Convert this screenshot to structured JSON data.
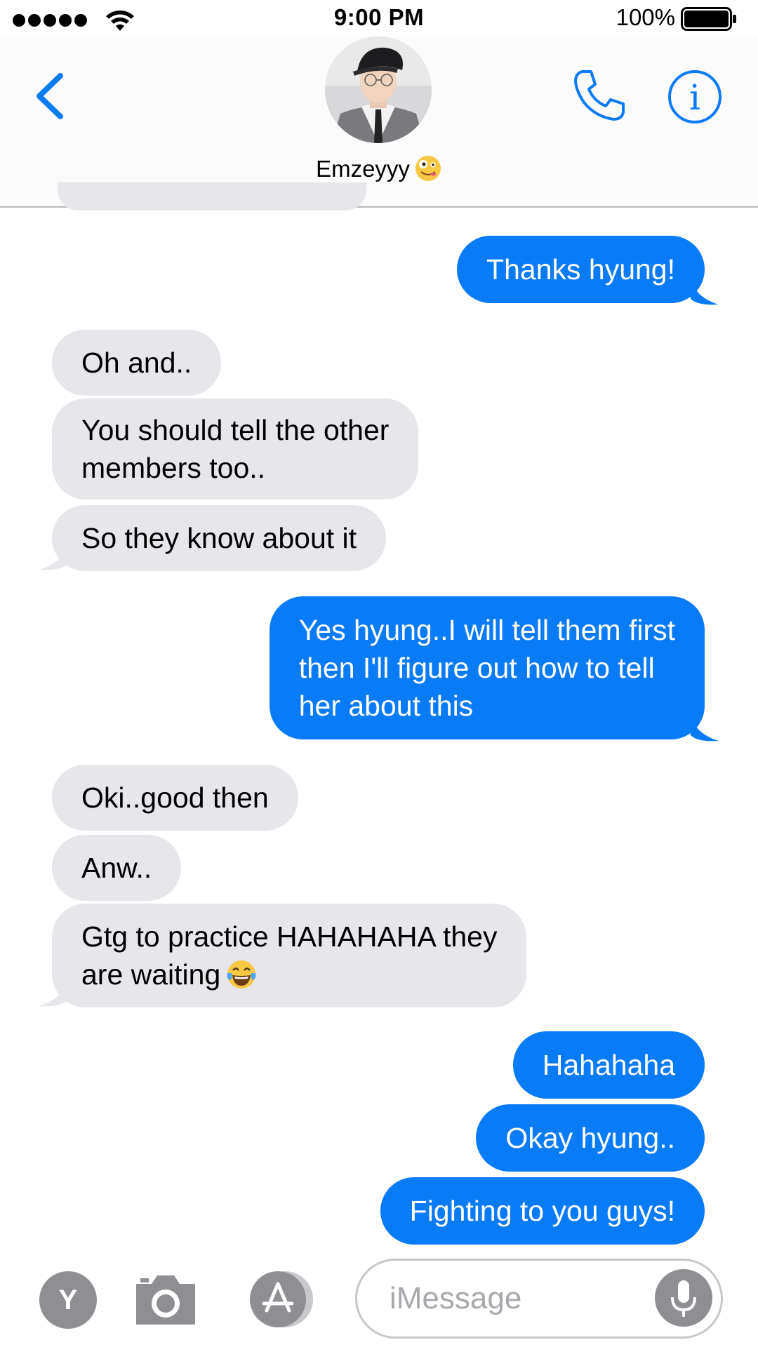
{
  "status_bar": {
    "time": "9:00 PM",
    "battery_percent": "100%",
    "signal_bars": 5,
    "battery_level": 1.0
  },
  "header": {
    "contact_name": "Emzeyyy",
    "contact_emoji": "zany-face-emoji",
    "back_icon": "chevron-left-icon",
    "phone_icon": "phone-icon",
    "info_icon": "info-icon"
  },
  "conversation": {
    "messages": [
      {
        "direction": "out",
        "text": "Thanks hyung!"
      },
      {
        "direction": "in",
        "text": "Oh and.."
      },
      {
        "direction": "in",
        "lines": [
          "You should tell the other",
          "members too.."
        ]
      },
      {
        "direction": "in",
        "text": "So they know about it"
      },
      {
        "direction": "out",
        "lines": [
          "Yes hyung..I will tell them first",
          "then I'll figure out how to tell",
          "her about this"
        ]
      },
      {
        "direction": "in",
        "text": "Oki..good then"
      },
      {
        "direction": "in",
        "text": "Anw.."
      },
      {
        "direction": "in",
        "lines": [
          "Gtg to practice HAHAHAHA they",
          "are waiting"
        ],
        "emoji": "face-with-tears-of-joy-emoji"
      },
      {
        "direction": "out",
        "text": "Hahahaha"
      },
      {
        "direction": "out",
        "text": "Okay hyung.."
      },
      {
        "direction": "out",
        "text": "Fighting to you guys!"
      }
    ]
  },
  "input_bar": {
    "apps_button_label": "Y",
    "camera_icon": "camera-icon",
    "appstore_icon": "app-store-icon",
    "placeholder": "iMessage",
    "mic_icon": "microphone-icon"
  },
  "colors": {
    "accent": "#0a7bf7",
    "incoming_bubble": "#e6e6eb",
    "icon_gray": "#8e8e93"
  }
}
